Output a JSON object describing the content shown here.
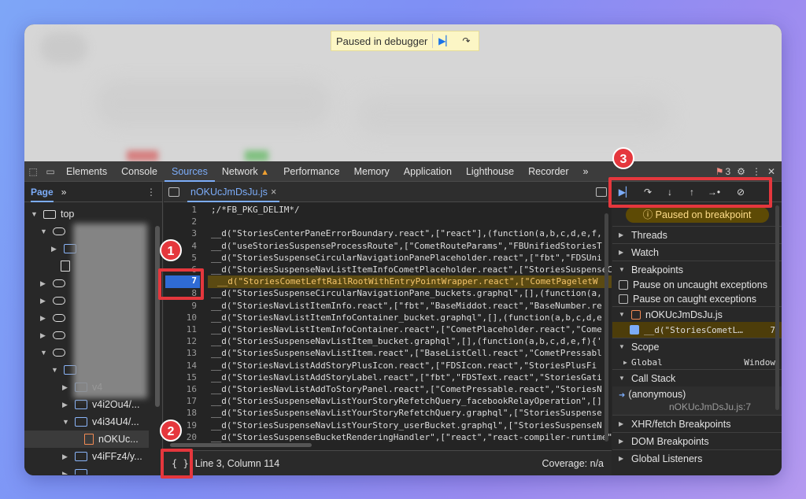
{
  "pausebar": {
    "label": "Paused in debugger",
    "resume_icon": "resume-icon",
    "step_icon": "step-over-icon"
  },
  "tabs": {
    "items": [
      "Elements",
      "Console",
      "Sources",
      "Network",
      "Performance",
      "Memory",
      "Application",
      "Lighthouse",
      "Recorder"
    ],
    "active": "Sources",
    "more": "»",
    "error_count": "3"
  },
  "navigator": {
    "tab": "Page",
    "more": "»",
    "top": "top",
    "items": [
      "v4",
      "v4i2Ou4/...",
      "v4i34U4/...",
      "nOKUc...",
      "v4iFFz4/y..."
    ]
  },
  "editor": {
    "file_tab": "nOKUcJmDsJu.js",
    "close": "×",
    "lines": [
      {
        "n": "1",
        "t": ";/*FB_PKG_DELIM*/"
      },
      {
        "n": "2",
        "t": ""
      },
      {
        "n": "3",
        "t": "__d(\"StoriesCenterPaneErrorBoundary.react\",[\"react\"],(function(a,b,c,d,e,f,"
      },
      {
        "n": "4",
        "t": "__d(\"useStoriesSuspenseProcessRoute\",[\"CometRouteParams\",\"FBUnifiedStoriesT"
      },
      {
        "n": "5",
        "t": "__d(\"StoriesSuspenseCircularNavigationPanePlaceholder.react\",[\"fbt\",\"FDSUni"
      },
      {
        "n": "6",
        "t": "__d(\"StoriesSuspenseNavListItemInfoCometPlaceholder.react\",[\"StoriesSuspenseCircu"
      },
      {
        "n": "7",
        "t": "__d(\"StoriesCometLeftRailRootWithEntryPointWrapper.react\",[\"CometPageletW"
      },
      {
        "n": "8",
        "t": "__d(\"StoriesSuspenseCircularNavigationPane_buckets.graphql\",[],(function(a,"
      },
      {
        "n": "9",
        "t": "__d(\"StoriesNavListItemInfo.react\",[\"fbt\",\"BaseMiddot.react\",\"BaseNumber.re"
      },
      {
        "n": "10",
        "t": "__d(\"StoriesNavListItemInfoContainer_bucket.graphql\",[],(function(a,b,c,d,e"
      },
      {
        "n": "11",
        "t": "__d(\"StoriesNavListItemInfoContainer.react\",[\"CometPlaceholder.react\",\"Come"
      },
      {
        "n": "12",
        "t": "__d(\"StoriesSuspenseNavListItem_bucket.graphql\",[],(function(a,b,c,d,e,f){'"
      },
      {
        "n": "13",
        "t": "__d(\"StoriesSuspenseNavListItem.react\",[\"BaseListCell.react\",\"CometPressabl"
      },
      {
        "n": "14",
        "t": "__d(\"StoriesNavListAddStoryPlusIcon.react\",[\"FDSIcon.react\",\"StoriesPlusFi"
      },
      {
        "n": "15",
        "t": "__d(\"StoriesNavListAddStoryLabel.react\",[\"fbt\",\"FDSText.react\",\"StoriesGati"
      },
      {
        "n": "16",
        "t": "__d(\"StoriesNavListAddToStoryPanel.react\",[\"CometPressable.react\",\"StoriesN"
      },
      {
        "n": "17",
        "t": "__d(\"StoriesSuspenseNavListYourStoryRefetchQuery_facebookRelayOperation\",[]"
      },
      {
        "n": "18",
        "t": "__d(\"StoriesSuspenseNavListYourStoryRefetchQuery.graphql\",[\"StoriesSuspense"
      },
      {
        "n": "19",
        "t": "__d(\"StoriesSuspenseNavListYourStory_userBucket.graphql\",[\"StoriesSuspenseN"
      },
      {
        "n": "20",
        "t": "__d(\"StoriesSuspenseBucketRenderingHandler\",[\"react\",\"react-compiler-runtime\""
      }
    ],
    "breakpoint_line": "7",
    "status_braces": "{ }",
    "status_position": "Line 3, Column 114",
    "status_coverage": "Coverage: n/a"
  },
  "debugger": {
    "paused_label": "Paused on breakpoint",
    "threads": "Threads",
    "watch": "Watch",
    "breakpoints": "Breakpoints",
    "pause_uncaught": "Pause on uncaught exceptions",
    "pause_caught": "Pause on caught exceptions",
    "bp_file": "nOKUcJmDsJu.js",
    "bp_code": "__d(\"StoriesCometL…",
    "bp_line": "7",
    "scope": "Scope",
    "global_key": "Global",
    "global_val": "Window",
    "call_stack": "Call Stack",
    "frame_name": "(anonymous)",
    "frame_loc": "nOKUcJmDsJu.js:7",
    "xhr": "XHR/fetch Breakpoints",
    "dom": "DOM Breakpoints",
    "listeners": "Global Listeners"
  },
  "callouts": [
    "1",
    "2",
    "3"
  ],
  "colors": {
    "accent": "#7cacf8",
    "callout_red": "#e5373d",
    "paused_bg": "#5d4a05",
    "breakpoint_blue": "#2f6bd5"
  }
}
